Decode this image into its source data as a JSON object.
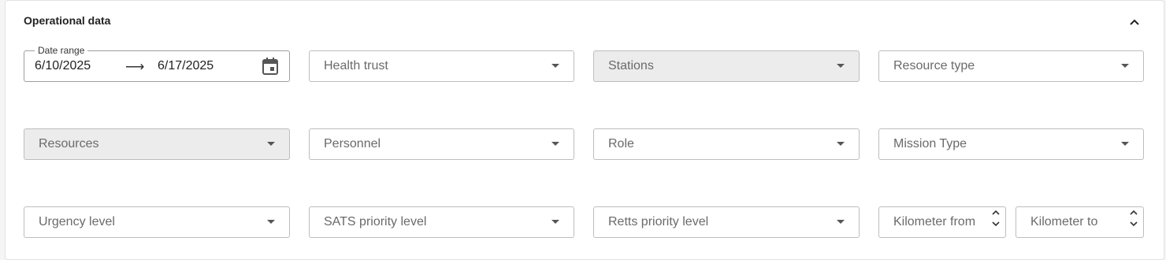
{
  "section": {
    "title": "Operational data"
  },
  "date_range": {
    "label": "Date range",
    "start": "6/10/2025",
    "end": "6/17/2025"
  },
  "fields": {
    "health_trust": "Health trust",
    "stations": "Stations",
    "resource_type": "Resource type",
    "resources": "Resources",
    "personnel": "Personnel",
    "role": "Role",
    "mission_type": "Mission Type",
    "urgency_level": "Urgency level",
    "sats_priority_level": "SATS priority level",
    "retts_priority_level": "Retts priority level",
    "kilometer_from": "Kilometer from",
    "kilometer_to": "Kilometer to"
  },
  "icons": {
    "collapse": "chevron-up-icon",
    "arrow": "arrow-right-icon",
    "calendar": "calendar-icon",
    "caret": "caret-down-icon"
  }
}
